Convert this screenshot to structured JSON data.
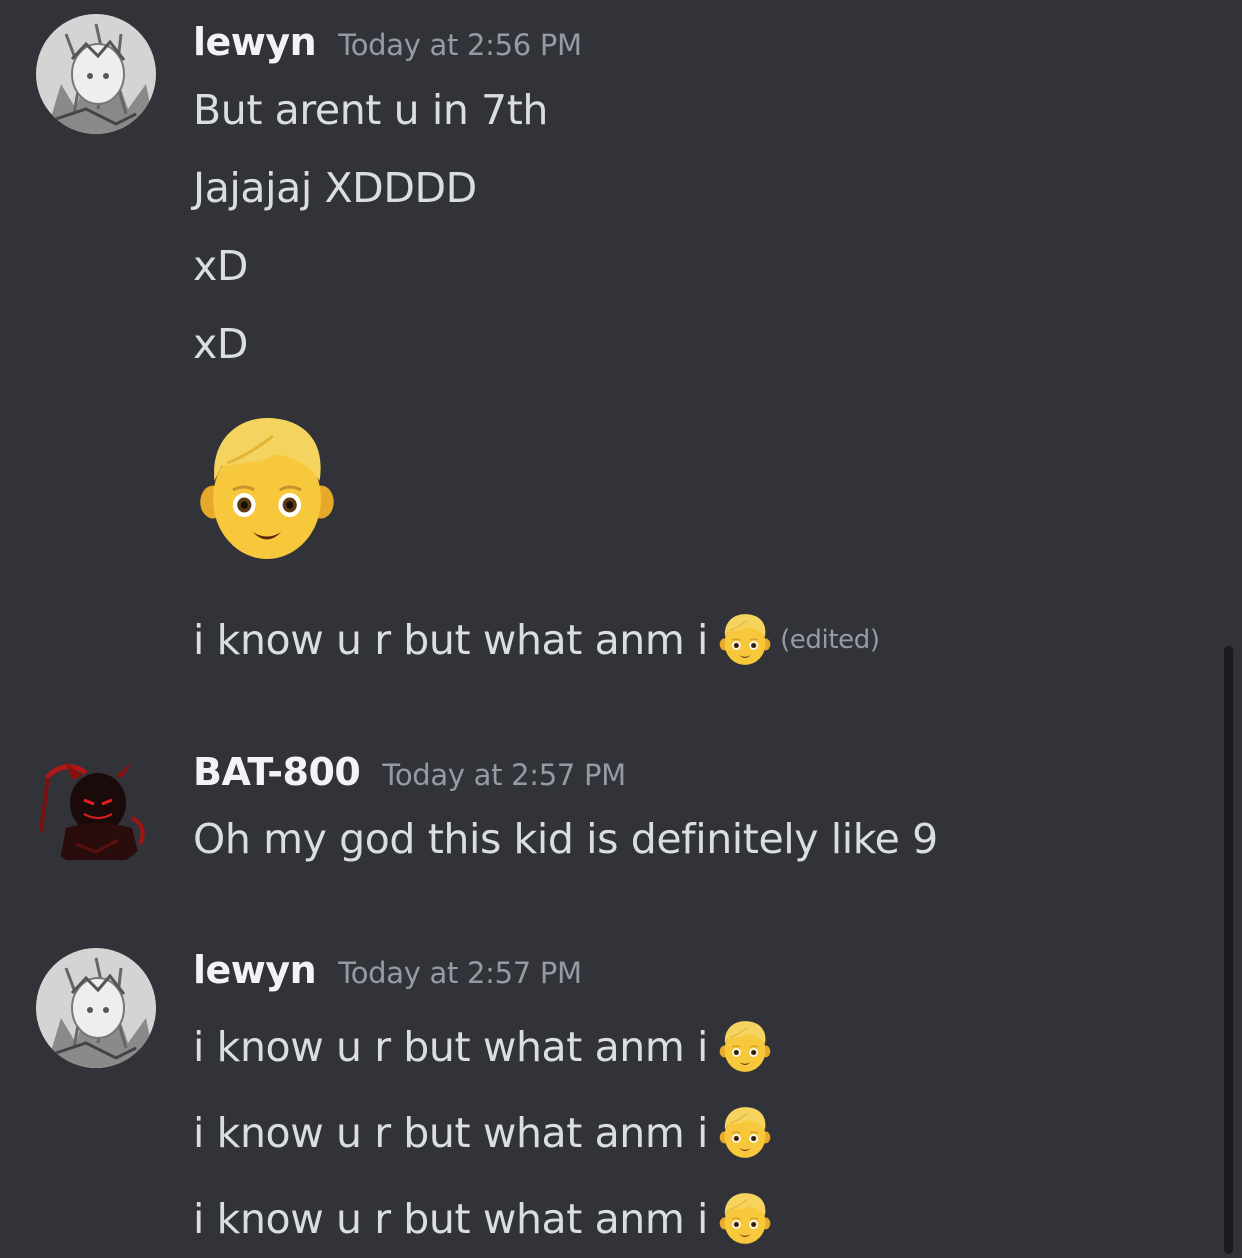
{
  "messages": [
    {
      "author": "lewyn",
      "timestamp": "Today at 2:56 PM",
      "avatar": "anime-avatar-grayscale",
      "lines": [
        "But arent u in 7th",
        "Jajajaj XDDDD",
        "xD",
        "xD"
      ],
      "big_emoji": "boy-emoji",
      "last_line": "i know u r but what anm i",
      "last_line_emoji": "boy-emoji",
      "edited_label": "(edited)"
    },
    {
      "author": "BAT-800",
      "timestamp": "Today at 2:57 PM",
      "avatar": "red-devil-avatar",
      "lines": [
        "Oh my god this kid is definitely like 9"
      ]
    },
    {
      "author": "lewyn",
      "timestamp": "Today at 2:57 PM",
      "avatar": "anime-avatar-grayscale",
      "lines": [
        "i know u r but what anm i",
        "i know u r but what anm i",
        "i know u r but what anm i"
      ],
      "line_emoji": "boy-emoji"
    }
  ],
  "colors": {
    "background": "#313338",
    "username": "#f2f3f5",
    "text": "#dbdee1",
    "muted": "#949ba4"
  }
}
